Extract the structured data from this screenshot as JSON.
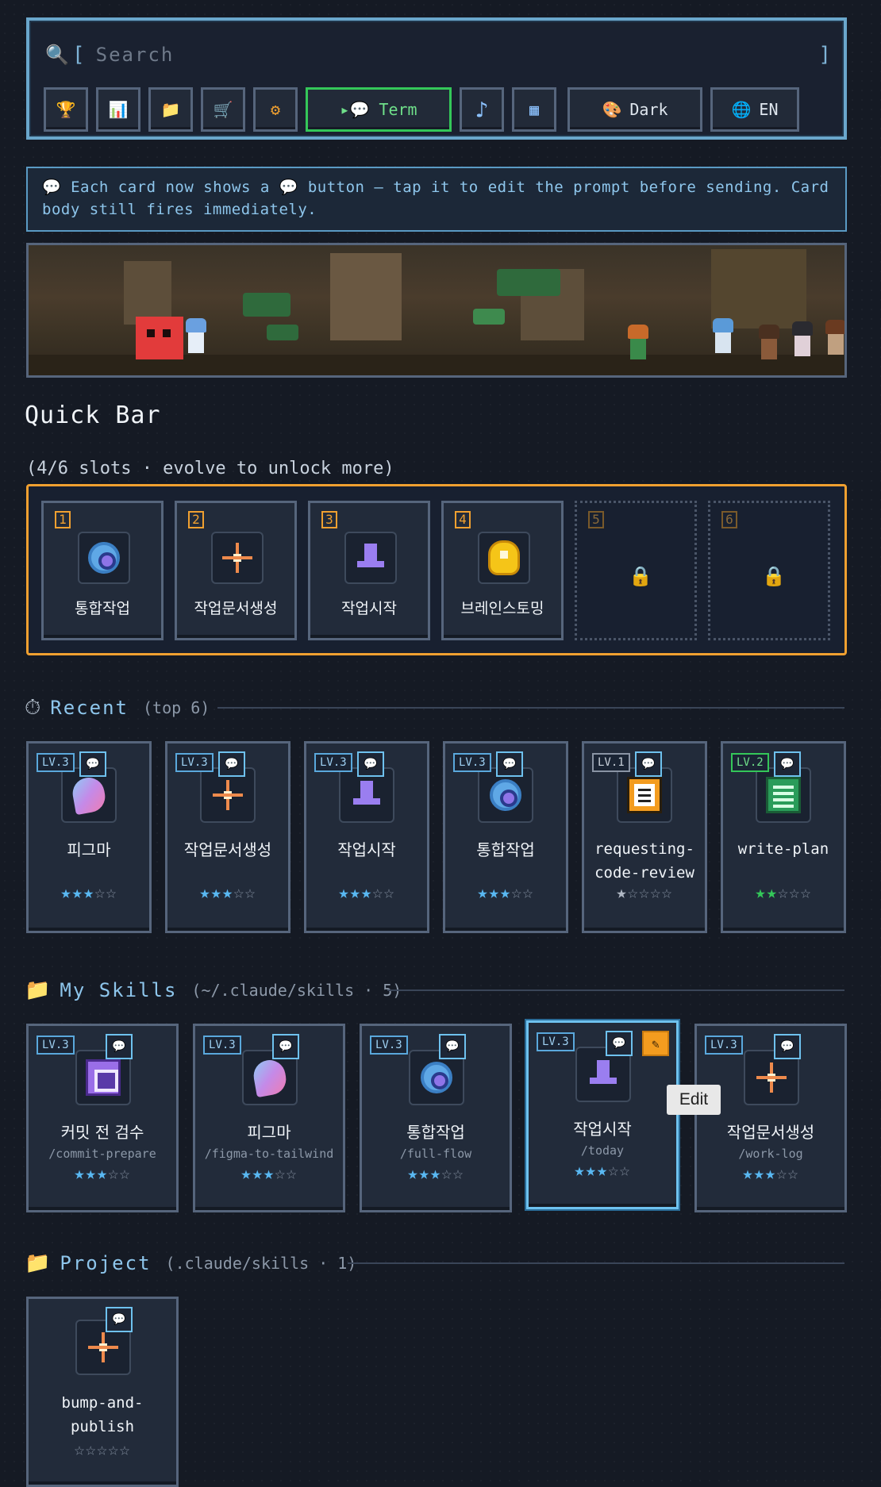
{
  "search": {
    "placeholder": "Search",
    "open_bracket": "[",
    "close_bracket": "]"
  },
  "toolbar": {
    "term_label": "▸💬 Term",
    "dark_label": "Dark",
    "lang_label": "EN",
    "icons": [
      "trophy-icon",
      "chart-icon",
      "folder-icon",
      "cart-icon",
      "gear-icon",
      "music-icon",
      "grid-icon",
      "palette-icon",
      "globe-icon"
    ]
  },
  "notice": "💬 Each card now shows a 💬 button — tap it to edit the prompt before sending. Card body still fires immediately.",
  "quickbar": {
    "title": "Quick Bar",
    "slots_info": "(4/6 slots · evolve to unlock more)",
    "slots": [
      {
        "num": "1",
        "label": "통합작업",
        "icon": "gem"
      },
      {
        "num": "2",
        "label": "작업문서생성",
        "icon": "spark"
      },
      {
        "num": "3",
        "label": "작업시작",
        "icon": "pawn"
      },
      {
        "num": "4",
        "label": "브레인스토밍",
        "icon": "bulb"
      },
      {
        "num": "5",
        "locked": true
      },
      {
        "num": "6",
        "locked": true
      }
    ]
  },
  "recent": {
    "title": "Recent",
    "sub": "(top 6)",
    "cards": [
      {
        "lv": "LV.3",
        "name": "피그마",
        "icon": "feather",
        "stars": 3
      },
      {
        "lv": "LV.3",
        "name": "작업문서생성",
        "icon": "spark",
        "stars": 3
      },
      {
        "lv": "LV.3",
        "name": "작업시작",
        "icon": "pawn",
        "stars": 3
      },
      {
        "lv": "LV.3",
        "name": "통합작업",
        "icon": "gem",
        "stars": 3
      },
      {
        "lv": "LV.1",
        "name": "requesting-code-review",
        "name1": "requesting-",
        "name2": "code-review",
        "icon": "doc",
        "stars": 1
      },
      {
        "lv": "LV.2",
        "name": "write-plan",
        "icon": "list",
        "stars": 2
      }
    ]
  },
  "my_skills": {
    "title": "My Skills",
    "sub": "(~/.claude/skills · 5)",
    "cards": [
      {
        "lv": "LV.3",
        "name": "커밋 전 검수",
        "slug": "/commit-prepare",
        "icon": "box",
        "stars": 3
      },
      {
        "lv": "LV.3",
        "name": "피그마",
        "slug": "/figma-to-tailwind",
        "icon": "feather",
        "stars": 3
      },
      {
        "lv": "LV.3",
        "name": "통합작업",
        "slug": "/full-flow",
        "icon": "gem",
        "stars": 3
      },
      {
        "lv": "LV.3",
        "name": "작업시작",
        "slug": "/today",
        "icon": "pawn",
        "stars": 3,
        "selected": true
      },
      {
        "lv": "LV.3",
        "name": "작업문서생성",
        "slug": "/work-log",
        "icon": "spark",
        "stars": 3
      }
    ],
    "tooltip": "Edit"
  },
  "project": {
    "title": "Project",
    "sub": "(.claude/skills · 1)",
    "cards": [
      {
        "name": "bump-and-publish",
        "name1": "bump-and-",
        "name2": "publish",
        "icon": "spark",
        "stars": 0
      }
    ]
  },
  "colors": {
    "accent": "#6ec1ee",
    "quickbar_border": "#f0a030",
    "term_border": "#34c759",
    "star_on": "#59b8f2"
  }
}
